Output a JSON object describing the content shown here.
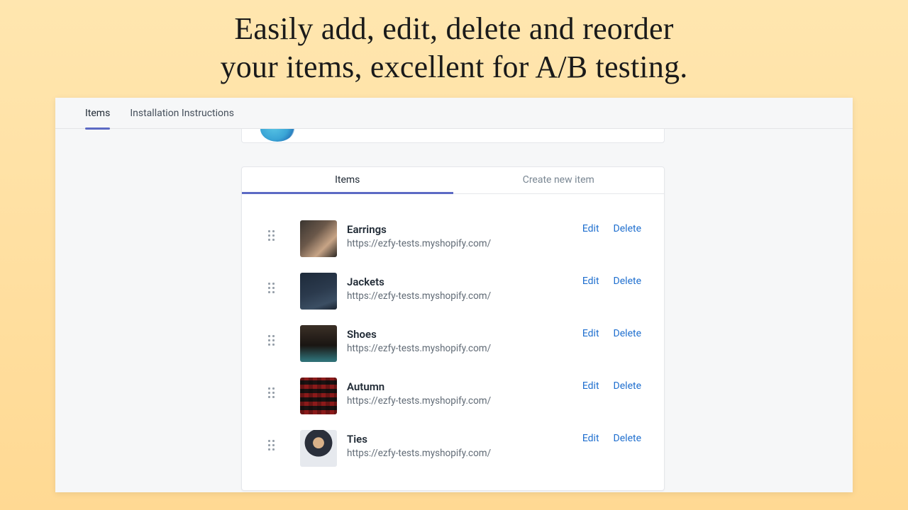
{
  "hero": {
    "line1": "Easily add, edit, delete and reorder",
    "line2": "your items, excellent for A/B testing."
  },
  "top_tabs": {
    "items": "Items",
    "install": "Installation Instructions"
  },
  "inner_tabs": {
    "items": "Items",
    "create": "Create new item"
  },
  "actions": {
    "edit": "Edit",
    "delete": "Delete"
  },
  "items": [
    {
      "title": "Earrings",
      "url": "https://ezfy-tests.myshopify.com/",
      "thumb": "earrings",
      "slug": "earrings"
    },
    {
      "title": "Jackets",
      "url": "https://ezfy-tests.myshopify.com/",
      "thumb": "jackets",
      "slug": "jackets"
    },
    {
      "title": "Shoes",
      "url": "https://ezfy-tests.myshopify.com/",
      "thumb": "shoes",
      "slug": "shoes"
    },
    {
      "title": "Autumn",
      "url": "https://ezfy-tests.myshopify.com/",
      "thumb": "autumn",
      "slug": "autumn"
    },
    {
      "title": "Ties",
      "url": "https://ezfy-tests.myshopify.com/",
      "thumb": "ties",
      "slug": "ties"
    }
  ]
}
